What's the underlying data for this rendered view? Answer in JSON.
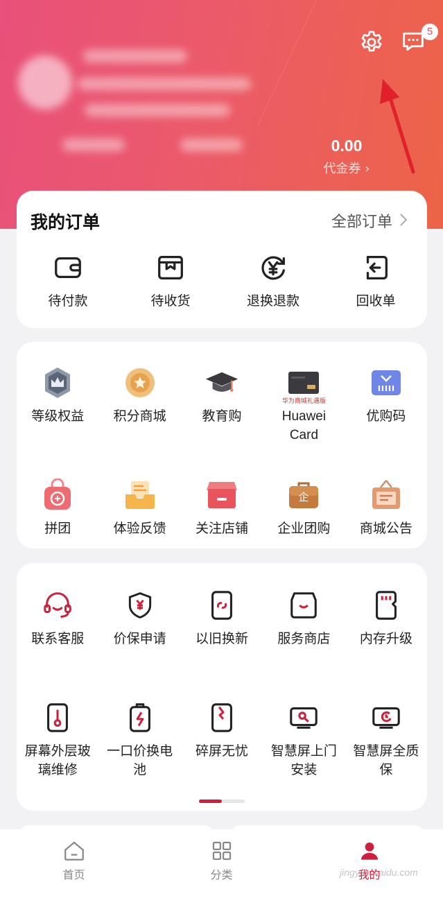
{
  "header": {
    "coupon_value": "0.00",
    "coupon_label": "代金券 ›",
    "message_count": "5",
    "gradient": [
      "#e9507a",
      "#ec6447"
    ]
  },
  "orders": {
    "title": "我的订单",
    "all_label": "全部订单",
    "items": [
      {
        "label": "待付款",
        "icon": "wallet-icon"
      },
      {
        "label": "待收货",
        "icon": "package-icon"
      },
      {
        "label": "退换退款",
        "icon": "yuan-refund-icon"
      },
      {
        "label": "回收单",
        "icon": "recycle-return-icon"
      }
    ]
  },
  "member": {
    "row1": [
      {
        "label": "等级权益",
        "icon": "crown-badge-icon"
      },
      {
        "label": "积分商城",
        "icon": "star-medal-icon"
      },
      {
        "label": "教育购",
        "icon": "graduation-cap-icon"
      },
      {
        "label": "Huawei Card",
        "icon": "gift-card-icon",
        "caption": "华为商城礼遇版"
      },
      {
        "label": "优购码",
        "icon": "barcode-icon"
      }
    ],
    "row2": [
      {
        "label": "拼团",
        "icon": "group-bag-icon"
      },
      {
        "label": "体验反馈",
        "icon": "feedback-box-icon"
      },
      {
        "label": "关注店铺",
        "icon": "store-icon"
      },
      {
        "label": "企业团购",
        "icon": "briefcase-icon"
      },
      {
        "label": "商城公告",
        "icon": "notice-bag-icon"
      }
    ]
  },
  "services": {
    "row1": [
      {
        "label": "联系客服",
        "icon": "headset-icon"
      },
      {
        "label": "价保申请",
        "icon": "price-shield-icon"
      },
      {
        "label": "以旧换新",
        "icon": "phone-trade-icon"
      },
      {
        "label": "服务商店",
        "icon": "service-store-icon"
      },
      {
        "label": "内存升级",
        "icon": "memory-card-icon"
      }
    ],
    "row2": [
      {
        "label": "屏幕外层玻璃维修",
        "icon": "screen-repair-icon"
      },
      {
        "label": "一口价换电池",
        "icon": "battery-icon"
      },
      {
        "label": "碎屏无忧",
        "icon": "broken-screen-icon"
      },
      {
        "label": "智慧屏上门安装",
        "icon": "tv-install-icon"
      },
      {
        "label": "智慧屏全质保",
        "icon": "tv-warranty-icon"
      }
    ]
  },
  "tabbar": [
    {
      "label": "首页",
      "icon": "home-icon"
    },
    {
      "label": "分类",
      "icon": "category-grid-icon"
    },
    {
      "label": "我的",
      "icon": "profile-icon"
    }
  ],
  "watermark": "jingyan.baidu.com",
  "accent_color": "#cf1f3f"
}
